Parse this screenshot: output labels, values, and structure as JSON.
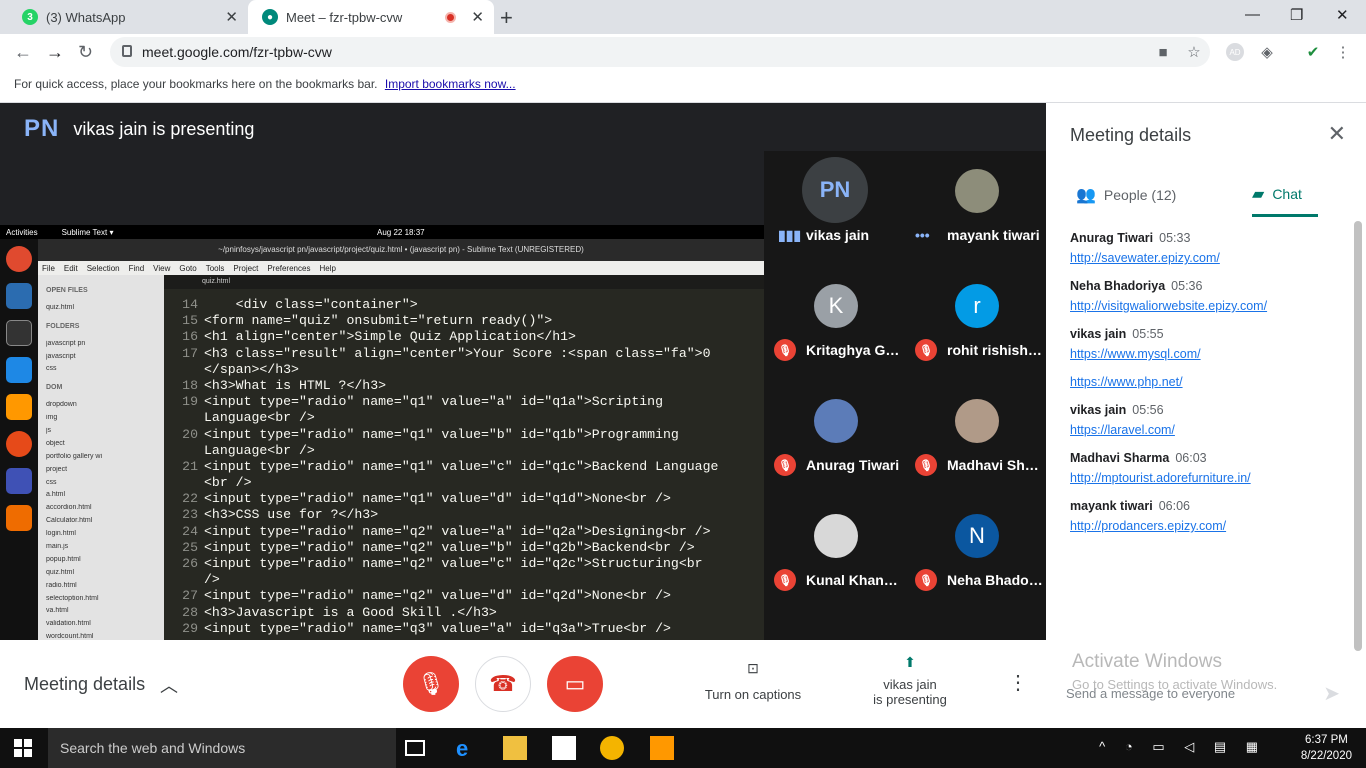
{
  "browser": {
    "tabs": [
      {
        "badge": "3",
        "title": "(3) WhatsApp"
      },
      {
        "title": "Meet – fzr-tpbw-cvw"
      }
    ],
    "url": "meet.google.com/fzr-tpbw-cvw",
    "bookmarks_hint": "For quick access, place your bookmarks here on the bookmarks bar.",
    "import_link": "Import bookmarks now...",
    "profile": "AD"
  },
  "meet": {
    "presenter_initials": "PN",
    "presenting_text": "vikas jain is presenting",
    "bottom": {
      "details_label": "Meeting details",
      "captions_label": "Turn on captions",
      "present_line1": "vikas jain",
      "present_line2": "is presenting"
    },
    "participants": [
      {
        "name": "vikas jain",
        "initial": "PN",
        "color": "#3c4043",
        "state": "speaking"
      },
      {
        "name": "mayank tiwari",
        "initial": "",
        "color": "#8d8d7a",
        "state": "dots"
      },
      {
        "name": "Kritaghya Gup...",
        "initial": "K",
        "color": "#9aa0a6",
        "state": "muted"
      },
      {
        "name": "rohit rishishwar",
        "initial": "r",
        "color": "#039be5",
        "state": "muted"
      },
      {
        "name": "Anurag Tiwari",
        "initial": "",
        "color": "#5c7cb8",
        "state": "muted"
      },
      {
        "name": "Madhavi Shar...",
        "initial": "",
        "color": "#b09a88",
        "state": "muted"
      },
      {
        "name": "Kunal Khande...",
        "initial": "",
        "color": "#d8d8d8",
        "state": "muted"
      },
      {
        "name": "Neha Bhadori...",
        "initial": "N",
        "color": "#0b57a0",
        "state": "muted"
      }
    ]
  },
  "panel": {
    "title": "Meeting details",
    "people_tab": "People (12)",
    "chat_tab": "Chat",
    "messages": [
      {
        "sender": "Anurag Tiwari",
        "time": "05:33",
        "links": [
          "http://savewater.epizy.com/"
        ]
      },
      {
        "sender": "Neha Bhadoriya",
        "time": "05:36",
        "links": [
          "http://visitgwaliorwebsite.epizy.com/"
        ]
      },
      {
        "sender": "vikas jain",
        "time": "05:55",
        "links": [
          "https://www.mysql.com/",
          "https://www.php.net/"
        ]
      },
      {
        "sender": "vikas jain",
        "time": "05:56",
        "links": [
          "https://laravel.com/"
        ]
      },
      {
        "sender": "Madhavi Sharma",
        "time": "06:03",
        "links": [
          "http://mptourist.adorefurniture.in/"
        ]
      },
      {
        "sender": "mayank tiwari",
        "time": "06:06",
        "links": [
          "http://prodancers.epizy.com/"
        ]
      }
    ],
    "input_placeholder": "Send a message to everyone",
    "watermark_title": "Activate Windows",
    "watermark_sub": "Go to Settings to activate Windows."
  },
  "shared_screen": {
    "topbar_activities": "Activities",
    "topbar_app": "Sublime Text ▾",
    "topbar_date": "Aug 22 18:37",
    "window_title": "~/pninfosys/javascript pn/javascript/project/quiz.html • (javascript pn) - Sublime Text (UNREGISTERED)",
    "menu": [
      "File",
      "Edit",
      "Selection",
      "Find",
      "View",
      "Goto",
      "Tools",
      "Project",
      "Preferences",
      "Help"
    ],
    "tab_name": "quiz.html",
    "sidebar": [
      "OPEN FILES",
      "quiz.html",
      "FOLDERS",
      "javascript pn",
      "javascript",
      "css",
      "DOM",
      "dropdown",
      "img",
      "js",
      "object",
      "portfolio gallery wi",
      "project",
      "css",
      "a.html",
      "accordion.html",
      "Calculator.html",
      "login.html",
      "main.js",
      "popup.html",
      "quiz.html",
      "radio.html",
      "selectoption.html",
      "va.html",
      "validation.html",
      "wordcount.html"
    ],
    "code": [
      {
        "n": "14",
        "text": "    <div class=\"container\">"
      },
      {
        "n": "15",
        "text": "<form name=\"quiz\" onsubmit=\"return ready()\">"
      },
      {
        "n": "16",
        "text": "<h1 align=\"center\">Simple Quiz Application</h1>"
      },
      {
        "n": "17",
        "text": "<h3 class=\"result\" align=\"center\">Your Score :<span class=\"fa\">0"
      },
      {
        "n": "",
        "text": "</span></h3>"
      },
      {
        "n": "18",
        "text": "<h3>What is HTML ?</h3>"
      },
      {
        "n": "19",
        "text": "<input type=\"radio\" name=\"q1\" value=\"a\" id=\"q1a\">Scripting"
      },
      {
        "n": "",
        "text": "Language<br />"
      },
      {
        "n": "20",
        "text": "<input type=\"radio\" name=\"q1\" value=\"b\" id=\"q1b\">Programming"
      },
      {
        "n": "",
        "text": "Language<br />"
      },
      {
        "n": "21",
        "text": "<input type=\"radio\" name=\"q1\" value=\"c\" id=\"q1c\">Backend Language"
      },
      {
        "n": "",
        "text": "<br />"
      },
      {
        "n": "22",
        "text": "<input type=\"radio\" name=\"q1\" value=\"d\" id=\"q1d\">None<br />"
      },
      {
        "n": "23",
        "text": "<h3>CSS use for ?</h3>"
      },
      {
        "n": "24",
        "text": "<input type=\"radio\" name=\"q2\" value=\"a\" id=\"q2a\">Designing<br />"
      },
      {
        "n": "25",
        "text": "<input type=\"radio\" name=\"q2\" value=\"b\" id=\"q2b\">Backend<br />"
      },
      {
        "n": "26",
        "text": "<input type=\"radio\" name=\"q2\" value=\"c\" id=\"q2c\">Structuring<br"
      },
      {
        "n": "",
        "text": "/>"
      },
      {
        "n": "27",
        "text": "<input type=\"radio\" name=\"q2\" value=\"d\" id=\"q2d\">None<br />"
      },
      {
        "n": "28",
        "text": "<h3>Javascript is a Good Skill .</h3>"
      },
      {
        "n": "29",
        "text": "<input type=\"radio\" name=\"q3\" value=\"a\" id=\"q3a\">True<br />"
      }
    ]
  },
  "taskbar": {
    "search_placeholder": "Search the web and Windows",
    "time": "6:37 PM",
    "date": "8/22/2020"
  },
  "colors": {
    "accent": "#00796b",
    "danger": "#ea4335",
    "link": "#1a73e8"
  }
}
